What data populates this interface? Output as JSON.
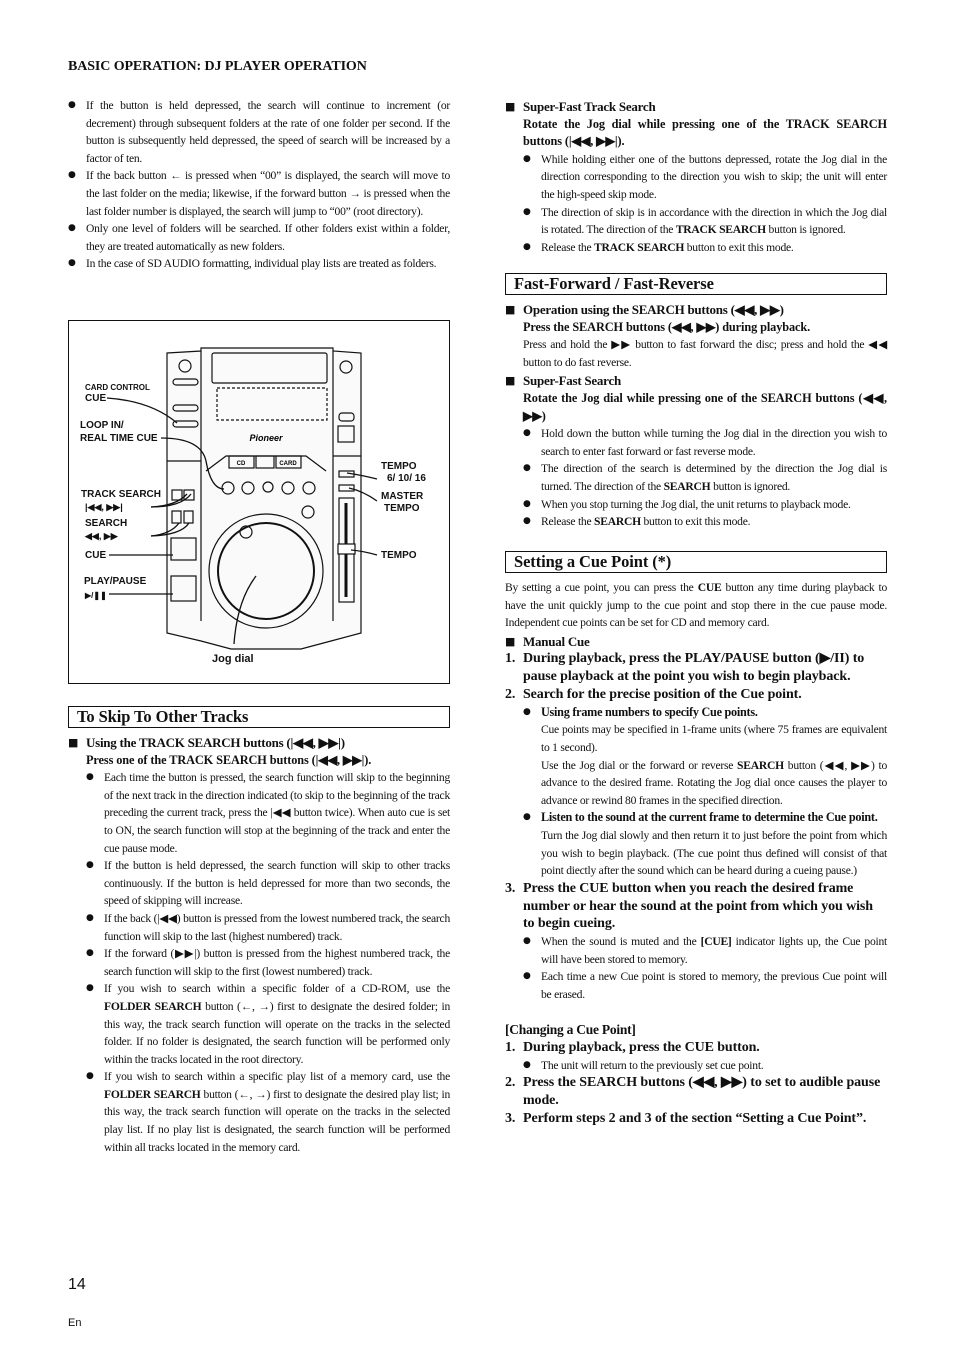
{
  "header": {
    "title": "BASIC OPERATION: DJ PLAYER OPERATION"
  },
  "left_intro": [
    {
      "type": "bullet",
      "lvl": 0,
      "seg": [
        "If the button is held depressed, the search will continue to increment (or decrement) through subsequent folders at the rate of one folder per second. If the button is subsequently held depressed, the speed of search will be increased by a factor of ten."
      ]
    },
    {
      "type": "bullet",
      "lvl": 0,
      "seg": [
        "If the back button ← is pressed when “00” is displayed, the search will move to the last folder on the media; likewise, if the forward button → is pressed when the last folder number is displayed, the search will jump to “00” (root directory)."
      ]
    },
    {
      "type": "bullet",
      "lvl": 0,
      "seg": [
        "Only one level of folders will be searched. If other folders exist within a folder, they are treated automatically as new folders."
      ]
    },
    {
      "type": "bullet",
      "lvl": 0,
      "seg": [
        "In the case of SD AUDIO formatting, individual play lists are treated as folders."
      ]
    }
  ],
  "figure": {
    "device": {
      "brand": "Pioneer",
      "cd": "CD",
      "card": "CARD"
    },
    "labels": {
      "card_control": "CARD CONTROL",
      "card_cue": "CUE",
      "loop_in": "LOOP IN/",
      "real_time_cue": "REAL TIME CUE",
      "track_search": "TRACK SEARCH",
      "track_search_sym": "|◀◀, ▶▶|",
      "search": "SEARCH",
      "search_sym": "◀◀, ▶▶",
      "cue": "CUE",
      "play_pause": "PLAY/PAUSE",
      "play_pause_sym": "▶/❚❚",
      "tempo_range": "TEMPO",
      "tempo_range_values": "6/  10/  16",
      "master": "MASTER",
      "master_tempo": "TEMPO",
      "tempo": "TEMPO",
      "jog_dial": "Jog dial"
    }
  },
  "left_skip": [
    {
      "type": "box",
      "seg": [
        "To Skip To Other Tracks"
      ]
    },
    {
      "type": "sq",
      "seg": [
        "Using the TRACK SEARCH buttons (|◀◀, ▶▶|)"
      ]
    },
    {
      "type": "instr",
      "seg": [
        "Press one of the TRACK SEARCH buttons (|◀◀, ▶▶|)."
      ]
    },
    {
      "type": "bullet",
      "lvl": 1,
      "seg": [
        "Each time the button is pressed, the search function will skip to the beginning of the next track in the direction indicated (to skip to the beginning of the track preceding the current track, press the |◀◀ button twice). When auto cue is set to ON, the search function will stop at the beginning of the track and enter the cue pause mode."
      ]
    },
    {
      "type": "bullet",
      "lvl": 1,
      "seg": [
        "If the button is held depressed, the search function will skip to other tracks continuously. If the button is held depressed for more than two seconds, the speed of skipping will increase."
      ]
    },
    {
      "type": "bullet",
      "lvl": 1,
      "seg": [
        "If the back (|◀◀) button is pressed from the lowest numbered track, the search function will skip to the last (highest numbered) track."
      ]
    },
    {
      "type": "bullet",
      "lvl": 1,
      "seg": [
        "If the forward (▶▶|) button is pressed from the highest numbered track, the search function will skip to the first (lowest numbered) track."
      ]
    },
    {
      "type": "bullet",
      "lvl": 1,
      "seg": [
        "If you wish to search within a specific folder of a CD-ROM, use the ",
        {
          "b": "FOLDER SEARCH"
        },
        " button (←, →) first to designate the desired folder; in this way, the track search function will operate on the tracks in the selected folder. If no folder is designated, the search function will be performed only within the tracks located in the root directory."
      ]
    },
    {
      "type": "bullet",
      "lvl": 1,
      "seg": [
        "If you wish to search within a specific play list of a memory card,  use the ",
        {
          "b": "FOLDER SEARCH"
        },
        " button (←, →) first to designate the desired play list; in this way, the track search function will operate on the tracks in the selected play list. If no play list is designated, the search function will be performed within all tracks located in the memory card."
      ]
    }
  ],
  "right_top": [
    {
      "type": "sq",
      "seg": [
        "Super-Fast Track Search"
      ]
    },
    {
      "type": "instr",
      "seg": [
        "Rotate the Jog dial while pressing one of the TRACK SEARCH buttons (|◀◀, ▶▶|)."
      ]
    },
    {
      "type": "bullet",
      "lvl": 1,
      "seg": [
        "While holding either one of the buttons depressed, rotate the Jog dial in the direction corresponding to the direction you wish to skip; the unit will enter the high-speed skip mode."
      ]
    },
    {
      "type": "bullet",
      "lvl": 1,
      "seg": [
        "The direction of skip is in accordance with the direction in which the Jog dial is rotated. The direction of the ",
        {
          "b": "TRACK SEARCH"
        },
        " button is ignored."
      ]
    },
    {
      "type": "bullet",
      "lvl": 1,
      "seg": [
        "Release the ",
        {
          "b": "TRACK SEARCH"
        },
        " button to exit this mode."
      ]
    }
  ],
  "right_ff": [
    {
      "type": "box",
      "seg": [
        "Fast-Forward / Fast-Reverse"
      ]
    },
    {
      "type": "sq",
      "seg": [
        "Operation using the SEARCH buttons (◀◀, ▶▶)"
      ]
    },
    {
      "type": "instr",
      "seg": [
        "Press the SEARCH buttons (◀◀, ▶▶) during playback."
      ]
    },
    {
      "type": "para",
      "lvl": 1,
      "seg": [
        "Press and hold the ▶▶ button to fast forward the disc; press and hold the ◀◀ button to do fast reverse."
      ]
    },
    {
      "type": "sq",
      "seg": [
        "Super-Fast Search"
      ]
    },
    {
      "type": "instr",
      "seg": [
        "Rotate the Jog dial while pressing one of the SEARCH buttons (◀◀, ▶▶)"
      ]
    },
    {
      "type": "bullet",
      "lvl": 1,
      "seg": [
        "Hold down the button while turning the Jog dial in the direction you wish to search to enter fast forward or fast reverse mode."
      ]
    },
    {
      "type": "bullet",
      "lvl": 1,
      "seg": [
        "The direction of the search is determined by the direction the Jog dial is turned. The direction of the ",
        {
          "b": "SEARCH"
        },
        " button is ignored."
      ]
    },
    {
      "type": "bullet",
      "lvl": 1,
      "seg": [
        "When you stop turning the Jog dial, the unit returns to playback mode."
      ]
    },
    {
      "type": "bullet",
      "lvl": 1,
      "seg": [
        "Release the ",
        {
          "b": "SEARCH"
        },
        " button to exit this mode."
      ]
    }
  ],
  "right_cue": [
    {
      "type": "box",
      "seg": [
        "Setting a Cue Point (*)"
      ]
    },
    {
      "type": "para",
      "lvl": 0,
      "seg": [
        "By setting a cue point, you can press the ",
        {
          "b": "CUE"
        },
        " button any time during playback to have the unit quickly jump to the cue point and stop there in the cue pause mode. Independent cue points can be set for CD and memory card."
      ]
    },
    {
      "type": "sq",
      "seg": [
        "Manual Cue"
      ]
    },
    {
      "type": "num",
      "n": "1.",
      "seg": [
        "During playback, press the PLAY/PAUSE button (▶/II) to pause playback at the point you wish to begin playback."
      ]
    },
    {
      "type": "num",
      "n": "2.",
      "seg": [
        "Search for the precise position of the Cue point."
      ]
    },
    {
      "type": "bbullet",
      "seg": [
        "Using frame numbers to specify Cue points."
      ]
    },
    {
      "type": "para",
      "lvl": 2,
      "seg": [
        "Cue points may be specified in 1-frame units (where 75 frames are equivalent to 1 second)."
      ]
    },
    {
      "type": "para",
      "lvl": 2,
      "seg": [
        "Use the Jog dial or the forward or reverse ",
        {
          "b": "SEARCH"
        },
        " button (◀◀, ▶▶) to advance to the desired frame. Rotating the Jog dial once causes the player to advance or rewind 80 frames in the specified direction."
      ]
    },
    {
      "type": "bbullet",
      "seg": [
        "Listen to the sound at the current frame to determine the Cue point."
      ]
    },
    {
      "type": "para",
      "lvl": 2,
      "seg": [
        "Turn the Jog dial slowly and then return it to just before the point from which you wish to begin playback. (The cue point thus defined will consist of that point diectly after the sound which can be heard during a cueing pause.)"
      ]
    },
    {
      "type": "num",
      "n": "3.",
      "seg": [
        "Press the CUE button when you reach the desired frame number or hear the sound at the point from which you wish to begin cueing."
      ]
    },
    {
      "type": "bullet",
      "lvl": 1,
      "seg": [
        "When the sound is muted and the ",
        {
          "b": "[CUE]"
        },
        " indicator lights up, the Cue point will have been stored to memory."
      ]
    },
    {
      "type": "bullet",
      "lvl": 1,
      "seg": [
        "Each time a new Cue point is stored to memory, the previous Cue point will be erased."
      ]
    },
    {
      "type": "bracket",
      "seg": [
        "[Changing a Cue Point]"
      ]
    },
    {
      "type": "num",
      "n": "1.",
      "seg": [
        "During playback, press the CUE button."
      ]
    },
    {
      "type": "bullet",
      "lvl": 1,
      "seg": [
        "The unit will return to the previously set cue point."
      ]
    },
    {
      "type": "num",
      "n": "2.",
      "seg": [
        "Press the SEARCH buttons (◀◀, ▶▶) to set to audible pause mode."
      ]
    },
    {
      "type": "num",
      "n": "3.",
      "seg": [
        "Perform steps 2 and 3 of the section “Setting a Cue Point”."
      ]
    }
  ],
  "footer": {
    "page_number": "14",
    "language": "En"
  }
}
